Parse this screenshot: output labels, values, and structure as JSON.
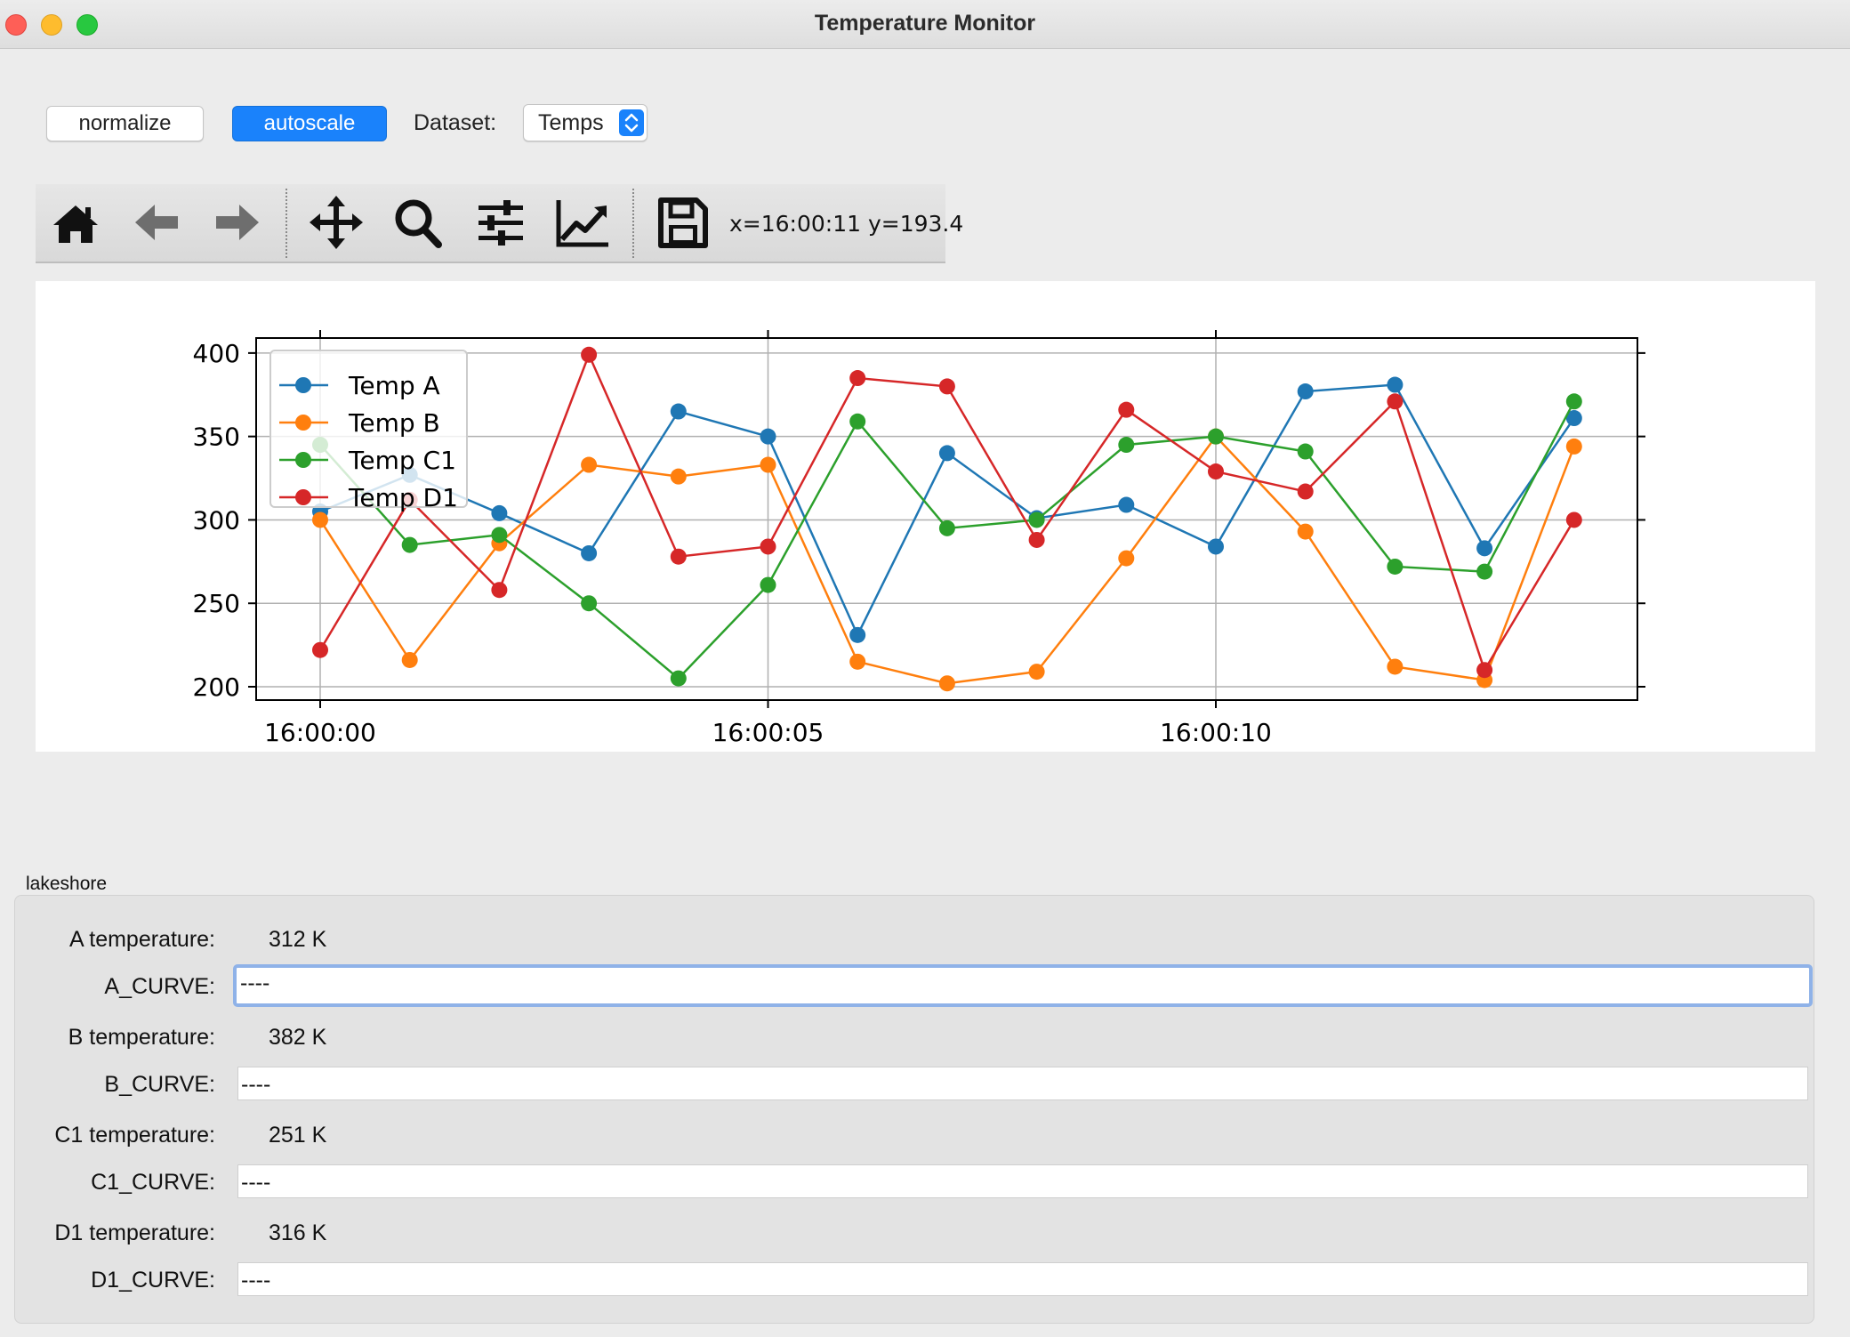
{
  "window": {
    "title": "Temperature Monitor"
  },
  "controls": {
    "normalize_label": "normalize",
    "autoscale_label": "autoscale",
    "dataset_label": "Dataset:",
    "dataset_value": "Temps"
  },
  "toolbar": {
    "tools": [
      "home-icon",
      "back-arrow-icon",
      "forward-arrow-icon",
      "pan-icon",
      "zoom-icon",
      "configure-subplots-icon",
      "edit-axis-icon",
      "save-icon"
    ],
    "coordinates": "x=16:00:11 y=193.4"
  },
  "chart_data": {
    "type": "line",
    "x": [
      "16:00:00",
      "16:00:01",
      "16:00:02",
      "16:00:03",
      "16:00:04",
      "16:00:05",
      "16:00:06",
      "16:00:07",
      "16:00:08",
      "16:00:09",
      "16:00:10",
      "16:00:11",
      "16:00:12",
      "16:00:13",
      "16:00:14"
    ],
    "x_ticks": [
      "16:00:00",
      "16:00:05",
      "16:00:10"
    ],
    "y_ticks": [
      200,
      250,
      300,
      350,
      400
    ],
    "ylim": [
      192,
      409
    ],
    "grid": true,
    "legend_position": "upper-left",
    "series": [
      {
        "name": "Temp A",
        "color": "#1f77b4",
        "values": [
          305,
          327,
          304,
          280,
          365,
          350,
          231,
          340,
          301,
          309,
          284,
          377,
          381,
          283,
          361
        ]
      },
      {
        "name": "Temp B",
        "color": "#ff7f0e",
        "values": [
          300,
          216,
          286,
          333,
          326,
          333,
          215,
          202,
          209,
          277,
          350,
          293,
          212,
          204,
          344
        ]
      },
      {
        "name": "Temp C1",
        "color": "#2ca02c",
        "values": [
          345,
          285,
          291,
          250,
          205,
          261,
          359,
          295,
          300,
          345,
          350,
          341,
          272,
          269,
          371
        ]
      },
      {
        "name": "Temp D1",
        "color": "#d62728",
        "values": [
          222,
          312,
          258,
          399,
          278,
          284,
          385,
          380,
          288,
          366,
          329,
          317,
          371,
          210,
          300
        ]
      }
    ]
  },
  "lakeshore": {
    "group_title": "lakeshore",
    "rows": [
      {
        "temp_label": "A temperature:",
        "temp_value": "312 K",
        "curve_label": "A_CURVE:",
        "curve_value": "----"
      },
      {
        "temp_label": "B temperature:",
        "temp_value": "382 K",
        "curve_label": "B_CURVE:",
        "curve_value": "----"
      },
      {
        "temp_label": "C1 temperature:",
        "temp_value": "251 K",
        "curve_label": "C1_CURVE:",
        "curve_value": "----"
      },
      {
        "temp_label": "D1 temperature:",
        "temp_value": "316 K",
        "curve_label": "D1_CURVE:",
        "curve_value": "----"
      }
    ]
  }
}
